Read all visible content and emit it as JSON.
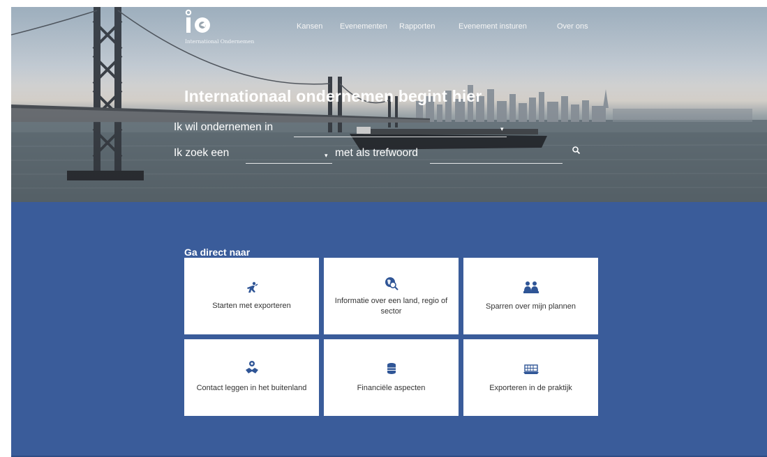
{
  "brand": {
    "logo_text": "International Ondernemen"
  },
  "nav": {
    "items": [
      "Kansen",
      "Evenementen",
      "Rapporten",
      "Evenement insturen",
      "Over ons"
    ]
  },
  "hero": {
    "title": "Internationaal ondernemen begint hier",
    "row1_label": "Ik wil ondernemen in",
    "row2_label_a": "Ik zoek een",
    "row2_label_b": "met als trefwoord",
    "search_icon": "search-icon"
  },
  "section": {
    "title": "Ga direct naar",
    "tiles": [
      {
        "label": "Starten met exporteren",
        "icon": "starter-runner-icon"
      },
      {
        "label": "Informatie over een land, regio of sector",
        "icon": "globe-search-icon"
      },
      {
        "label": "Sparren over mijn plannen",
        "icon": "people-meeting-icon"
      },
      {
        "label": "Contact leggen in het buitenland",
        "icon": "handshake-contact-icon"
      },
      {
        "label": "Financiële aspecten",
        "icon": "coin-stack-icon"
      },
      {
        "label": "Exporteren in de praktijk",
        "icon": "cargo-container-icon"
      }
    ]
  },
  "colors": {
    "section_blue": "#3a5c9a",
    "tile_bg": "#ffffff",
    "icon_blue": "#2f5596",
    "hero_text": "#ffffff"
  }
}
